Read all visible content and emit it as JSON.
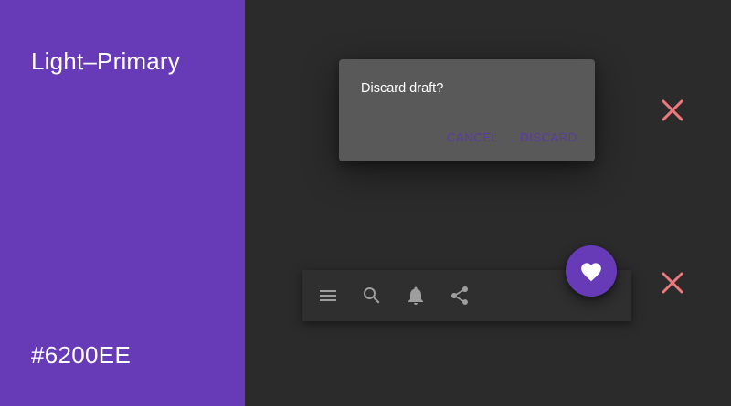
{
  "panel": {
    "title": "Light–Primary",
    "hex": "#6200EE",
    "background_color": "#673ab7"
  },
  "dialog": {
    "message": "Discard draft?",
    "cancel_label": "CANCEL",
    "discard_label": "DISCARD"
  },
  "app_bar": {
    "icons": [
      "menu-icon",
      "search-icon",
      "bell-icon",
      "share-icon"
    ]
  },
  "fab": {
    "icon": "heart-icon"
  },
  "marks": {
    "icon": "close-icon",
    "color": "#f0787c"
  },
  "colors": {
    "accent": "#673ab7",
    "background": "#2b2b2b",
    "dialog_surface": "#595959",
    "icon": "#9e9e9e"
  }
}
